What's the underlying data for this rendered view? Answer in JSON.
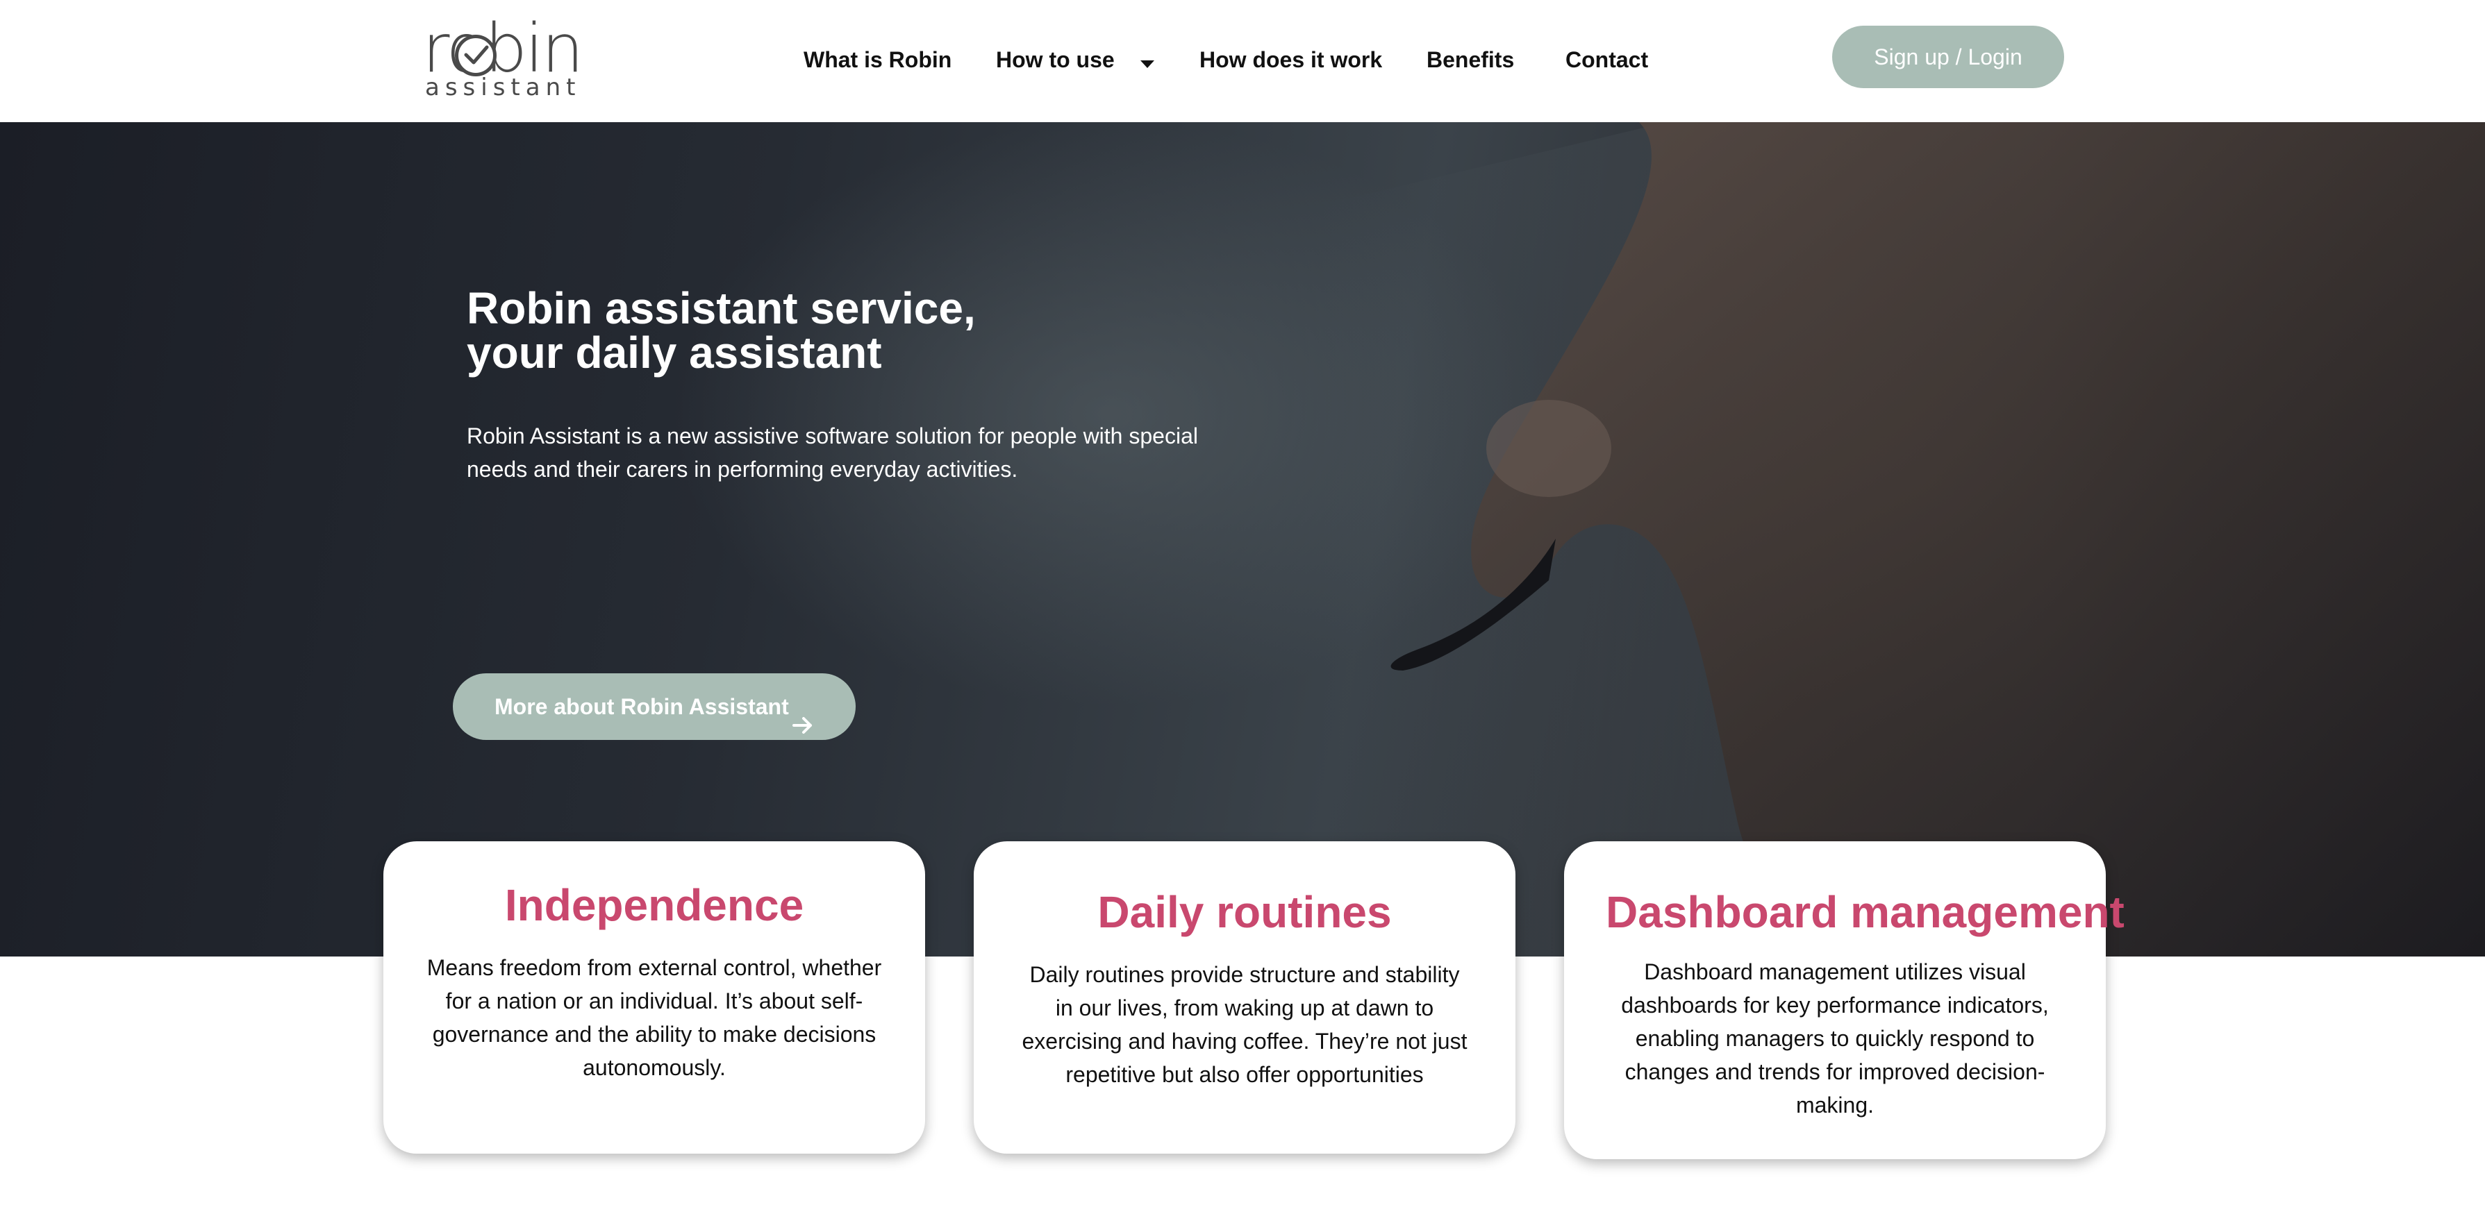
{
  "brand": {
    "logo_word": "robin",
    "logo_sub": "assistant"
  },
  "nav": {
    "items": [
      {
        "label": "What is Robin"
      },
      {
        "label": "How to use"
      },
      {
        "label": "How does it work"
      },
      {
        "label": "Benefits"
      },
      {
        "label": "Contact"
      }
    ],
    "signup_label": "Sign up / Login"
  },
  "hero": {
    "title_line1": "Robin assistant service,",
    "title_line2": "your daily assistant",
    "description": "Robin Assistant is a new assistive software solution for people with special needs and their carers in performing everyday activities.",
    "button_label": "More about Robin Assistant"
  },
  "cards": [
    {
      "title": "Independence",
      "text": "Means freedom from external control, whether for a nation or an individual. It’s about self-governance and the ability to make decisions autonomously."
    },
    {
      "title": "Daily routines",
      "text": "Daily routines provide structure and stability in our lives, from waking up at dawn to exercising and having coffee. They’re not just repetitive but also offer opportunities"
    },
    {
      "title": "Dashboard management",
      "text": "Dashboard management utilizes visual dashboards for key performance indicators, enabling managers to quickly respond to changes and trends for improved decision-making."
    }
  ],
  "colors": {
    "accent_button": "#a9bdb5",
    "card_title": "#c9486e",
    "hero_dark": "#1f2128"
  }
}
